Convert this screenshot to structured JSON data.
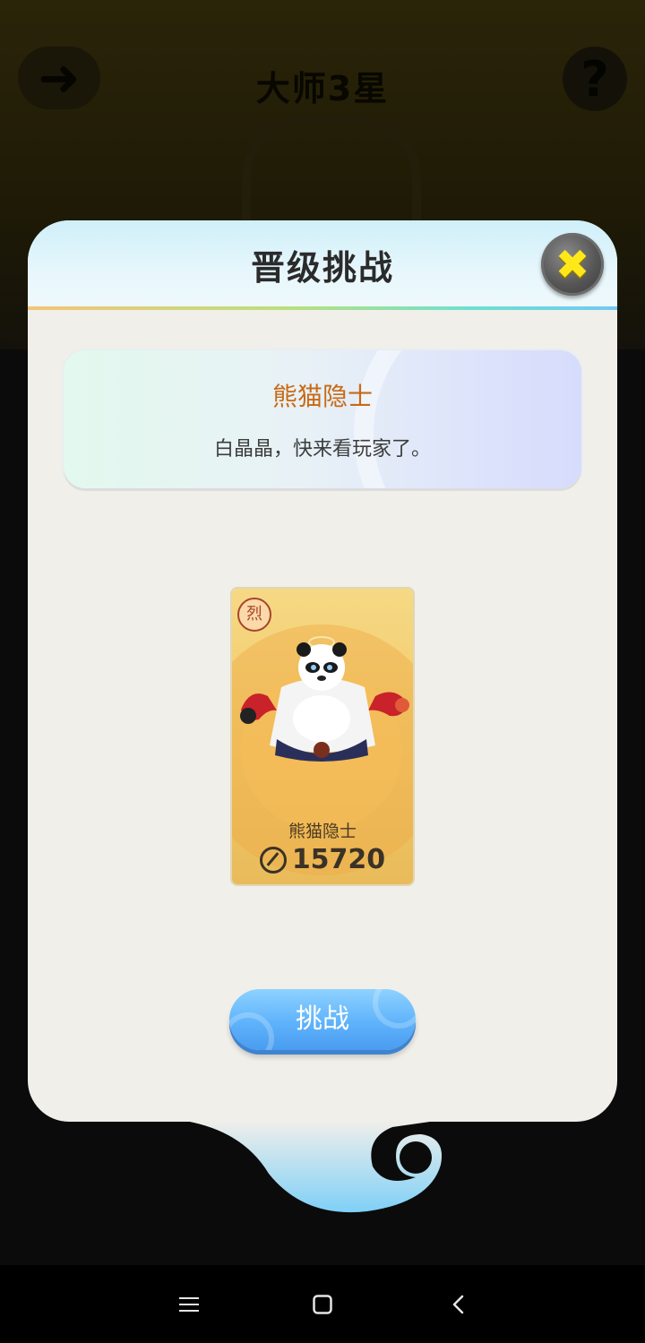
{
  "background": {
    "title": "大师3星",
    "back_icon": "back-arrow-icon",
    "help_icon": "question-icon"
  },
  "modal": {
    "title": "晋级挑战",
    "close_icon": "close-icon",
    "info": {
      "name": "熊猫隐士",
      "description": "白晶晶，快来看玩家了。"
    },
    "character": {
      "element_badge": "烈",
      "name": "熊猫隐士",
      "power": "15720"
    },
    "challenge_button": "挑战"
  },
  "navbar": {
    "menu_icon": "menu-icon",
    "home_icon": "home-icon",
    "back_icon": "back-icon"
  },
  "colors": {
    "accent_orange": "#c86a16",
    "button_blue": "#5fb3fb",
    "close_yellow": "#ffe81a"
  }
}
